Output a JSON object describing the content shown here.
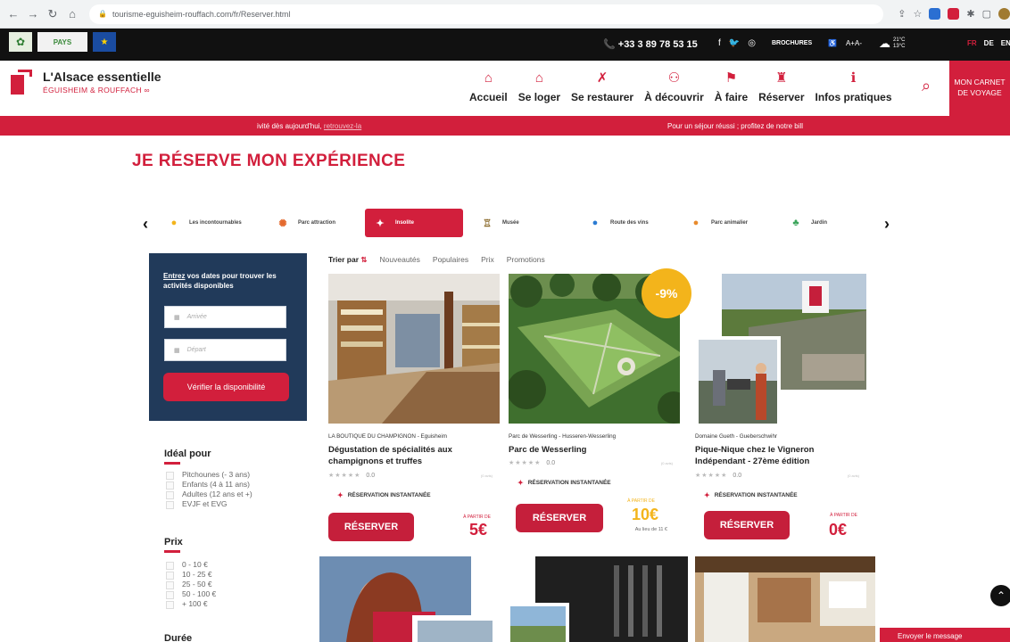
{
  "browser": {
    "url": "tourisme-eguisheim-rouffach.com/fr/Reserver.html"
  },
  "topbar": {
    "pays_logo": "PAYS",
    "phone": "+33 3 89 78 53 15",
    "social": [
      "f",
      "🐦",
      "◎"
    ],
    "brochures": "BROCHURES",
    "font_size": "A+A-",
    "weather_high": "21°C",
    "weather_low": "13°C",
    "lang": [
      "FR",
      "DE",
      "EN"
    ]
  },
  "header": {
    "brand_title": "L'Alsace essentielle",
    "brand_sub": "ÉGUISHEIM & ROUFFACH",
    "menu": [
      {
        "label": "Accueil",
        "icon": "house-icon",
        "glyph": "⌂"
      },
      {
        "label": "Se loger",
        "icon": "bed-icon",
        "glyph": "⌂"
      },
      {
        "label": "Se restaurer",
        "icon": "cutlery-icon",
        "glyph": "✗"
      },
      {
        "label": "À découvrir",
        "icon": "binoculars-icon",
        "glyph": "⚇"
      },
      {
        "label": "À faire",
        "icon": "signpost-icon",
        "glyph": "⚑"
      },
      {
        "label": "Réserver",
        "icon": "reception-bell-icon",
        "glyph": "♜"
      },
      {
        "label": "Infos pratiques",
        "icon": "info-icon",
        "glyph": "ℹ"
      }
    ],
    "carnet": [
      "MON CARNET",
      "DE VOYAGE"
    ]
  },
  "strip": {
    "left": "ivité dès aujourd'hui,",
    "left_link": "retrouvez-la",
    "right": "Pour un séjour réussi ; profitez de notre bill"
  },
  "page_title": "JE RÉSERVE MON EXPÉRIENCE",
  "categories": [
    {
      "label": "Les incontournables",
      "icon": "map-pin-icon",
      "color": "#f3b41b",
      "glyph": "●"
    },
    {
      "label": "Parc attraction",
      "icon": "ferris-wheel-icon",
      "color": "#e46a2e",
      "glyph": "✺"
    },
    {
      "label": "Insolite",
      "icon": "balloon-icon",
      "color": "#f3b41b",
      "glyph": "✦",
      "active": true
    },
    {
      "label": "Musée",
      "icon": "museum-icon",
      "color": "#8b6b2b",
      "glyph": "♖"
    },
    {
      "label": "Route des vins",
      "icon": "grape-icon",
      "color": "#2b7bd2",
      "glyph": "●"
    },
    {
      "label": "Parc animalier",
      "icon": "lion-icon",
      "color": "#e88a2c",
      "glyph": "●"
    },
    {
      "label": "Jardin",
      "icon": "tree-icon",
      "color": "#3aa45a",
      "glyph": "♣"
    }
  ],
  "datebox": {
    "intro_link": "Entrez",
    "intro": " vos dates pour trouver les activités disponibles",
    "arrival_placeholder": "Arrivée",
    "departure_placeholder": "Départ",
    "check_button": "Vérifier la disponibilité"
  },
  "filters": {
    "ideal_title": "Idéal pour",
    "ideal_options": [
      "Pitchounes (- 3 ans)",
      "Enfants (4 à 11 ans)",
      "Adultes (12 ans et +)",
      "EVJF et EVG"
    ],
    "price_title": "Prix",
    "price_options": [
      "0 - 10 €",
      "10 - 25 €",
      "25 - 50 €",
      "50 - 100 €",
      "+ 100 €"
    ],
    "duration_title": "Durée"
  },
  "sort": {
    "label": "Trier par",
    "options": [
      "Nouveautés",
      "Populaires",
      "Prix",
      "Promotions"
    ]
  },
  "cards": [
    {
      "provider": "LA BOUTIQUE DU CHAMPIGNON - Eguisheim",
      "title": "Dégustation de spécialités aux champignons et truffes",
      "rating": "0.0",
      "stars": "★★★★★",
      "reviews": "(0 avis)",
      "instant": "RÉSERVATION INSTANTANÉE",
      "book": "RÉSERVER",
      "from": "À PARTIR DE",
      "price": "5€"
    },
    {
      "provider": "Parc de Wesserling - Husseren-Wesserling",
      "title": "Parc de Wesserling",
      "rating": "0.0",
      "stars": "★★★★★",
      "reviews": "(0 avis)",
      "instant": "RÉSERVATION INSTANTANÉE",
      "book": "RÉSERVER",
      "from": "À PARTIR DE",
      "price": "10€",
      "was": "Au lieu de 11 €",
      "discount": "-9%"
    },
    {
      "provider": "Domaine Gueth - Gueberschwihr",
      "title": "Pique-Nique chez le Vigneron Indépendant - 27ème édition",
      "rating": "0.0",
      "stars": "★★★★★",
      "reviews": "(0 avis)",
      "instant": "RÉSERVATION INSTANTANÉE",
      "book": "RÉSERVER",
      "from": "À PARTIR DE",
      "price": "0€"
    }
  ],
  "message_button": "Envoyer le message"
}
